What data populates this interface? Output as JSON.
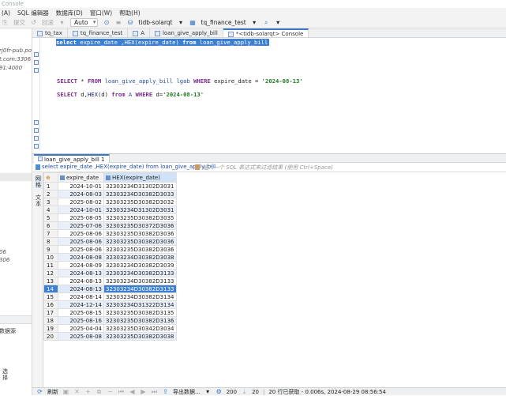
{
  "window": {
    "title": "Console"
  },
  "menu": [
    "(A)",
    "SQL 编辑器",
    "数据库(D)",
    "窗口(W)",
    "帮助(H)"
  ],
  "toolbar": {
    "commit": "提交",
    "rollback": "回滚",
    "mode": "Auto",
    "connection": "tidb-solarqt",
    "database": "tq_finance_test"
  },
  "sidebar": {
    "texts": [
      "rj0fr-pub.pola",
      "t.com:3306",
      "91:4000",
      "06",
      "306"
    ],
    "bottom_text": "数据源",
    "bottom_vlabel": "选择"
  },
  "editor_tabs": [
    {
      "label": "tq_tax",
      "active": false
    },
    {
      "label": "tq_finance_test",
      "active": false
    },
    {
      "label": "A",
      "active": false
    },
    {
      "label": "loan_give_apply_bill",
      "active": false
    },
    {
      "label": "*<tidb-solarqt> Console",
      "active": true
    }
  ],
  "editor": {
    "line1": {
      "kw1": "select",
      "col": " expire_date ,",
      "fn": "HEX",
      "rest": "(expire_date) ",
      "kw2": "from",
      "tbl": " loan_give_apply_bill"
    },
    "line2": {
      "kw1": "SELECT",
      "mid": " * ",
      "kw2": "FROM",
      "tbl": " loan_give_apply_bill lgab ",
      "kw3": "WHERE",
      "col": " expire_date = ",
      "str": "'2024-08-13'"
    },
    "line3": {
      "kw1": "SELECT",
      "mid": " d,",
      "fn": "HEX",
      "rest": "(d) ",
      "kw2": "from",
      "tbl": " A ",
      "kw3": "WHERE",
      "col": " d=",
      "str": "'2024-08-13'"
    }
  },
  "results": {
    "tab_label": "loan_give_apply_bill 1",
    "filter_sql": "select expire_date ,HEX(expire_date) from loan_give_apply_bill",
    "filter_placeholder": "输入一个 SQL 表达式来过滤结果 (使用 Ctrl+Space)",
    "side_labels": [
      "网格",
      "文本"
    ],
    "columns": [
      "expire_date",
      "HEX(expire_date)"
    ],
    "selected_row": 14,
    "rows": [
      {
        "n": "1",
        "date": "2024-10-01",
        "hex": "32303234D31302D3031"
      },
      {
        "n": "2",
        "date": "2024-08-03",
        "hex": "32303234D30382D3033"
      },
      {
        "n": "3",
        "date": "2025-08-02",
        "hex": "32303235D30382D3032"
      },
      {
        "n": "4",
        "date": "2024-10-01",
        "hex": "32303234D31302D3031"
      },
      {
        "n": "5",
        "date": "2025-08-05",
        "hex": "32303235D30382D3035"
      },
      {
        "n": "6",
        "date": "2025-07-06",
        "hex": "32303235D30372D3036"
      },
      {
        "n": "7",
        "date": "2025-08-06",
        "hex": "32303235D30382D3036"
      },
      {
        "n": "8",
        "date": "2025-08-06",
        "hex": "32303235D30382D3036"
      },
      {
        "n": "9",
        "date": "2025-08-06",
        "hex": "32303235D30382D3036"
      },
      {
        "n": "10",
        "date": "2024-08-08",
        "hex": "32303234D30382D3038"
      },
      {
        "n": "11",
        "date": "2024-08-09",
        "hex": "32303234D30382D3039"
      },
      {
        "n": "12",
        "date": "2024-08-13",
        "hex": "32303234D30382D3133"
      },
      {
        "n": "13",
        "date": "2024-08-13",
        "hex": "32303234D30382D3133"
      },
      {
        "n": "14",
        "date": "2024-08-13",
        "hex": "32303234D30382D3133"
      },
      {
        "n": "15",
        "date": "2024-08-14",
        "hex": "32303234D30382D3134"
      },
      {
        "n": "16",
        "date": "2024-12-14",
        "hex": "32303234D31322D3134"
      },
      {
        "n": "17",
        "date": "2025-08-15",
        "hex": "32303235D30382D3135"
      },
      {
        "n": "18",
        "date": "2025-08-16",
        "hex": "32303235D30382D3136"
      },
      {
        "n": "19",
        "date": "2025-04-04",
        "hex": "32303235D30342D3034"
      },
      {
        "n": "20",
        "date": "2025-08-08",
        "hex": "32303235D30382D3038"
      }
    ]
  },
  "status": {
    "refresh": "刷新",
    "export": "导出数据...",
    "fetch_size": "200",
    "count": "20",
    "summary": "20 行已获取 - 0.006s, 2024-08-29 08:56:54"
  }
}
